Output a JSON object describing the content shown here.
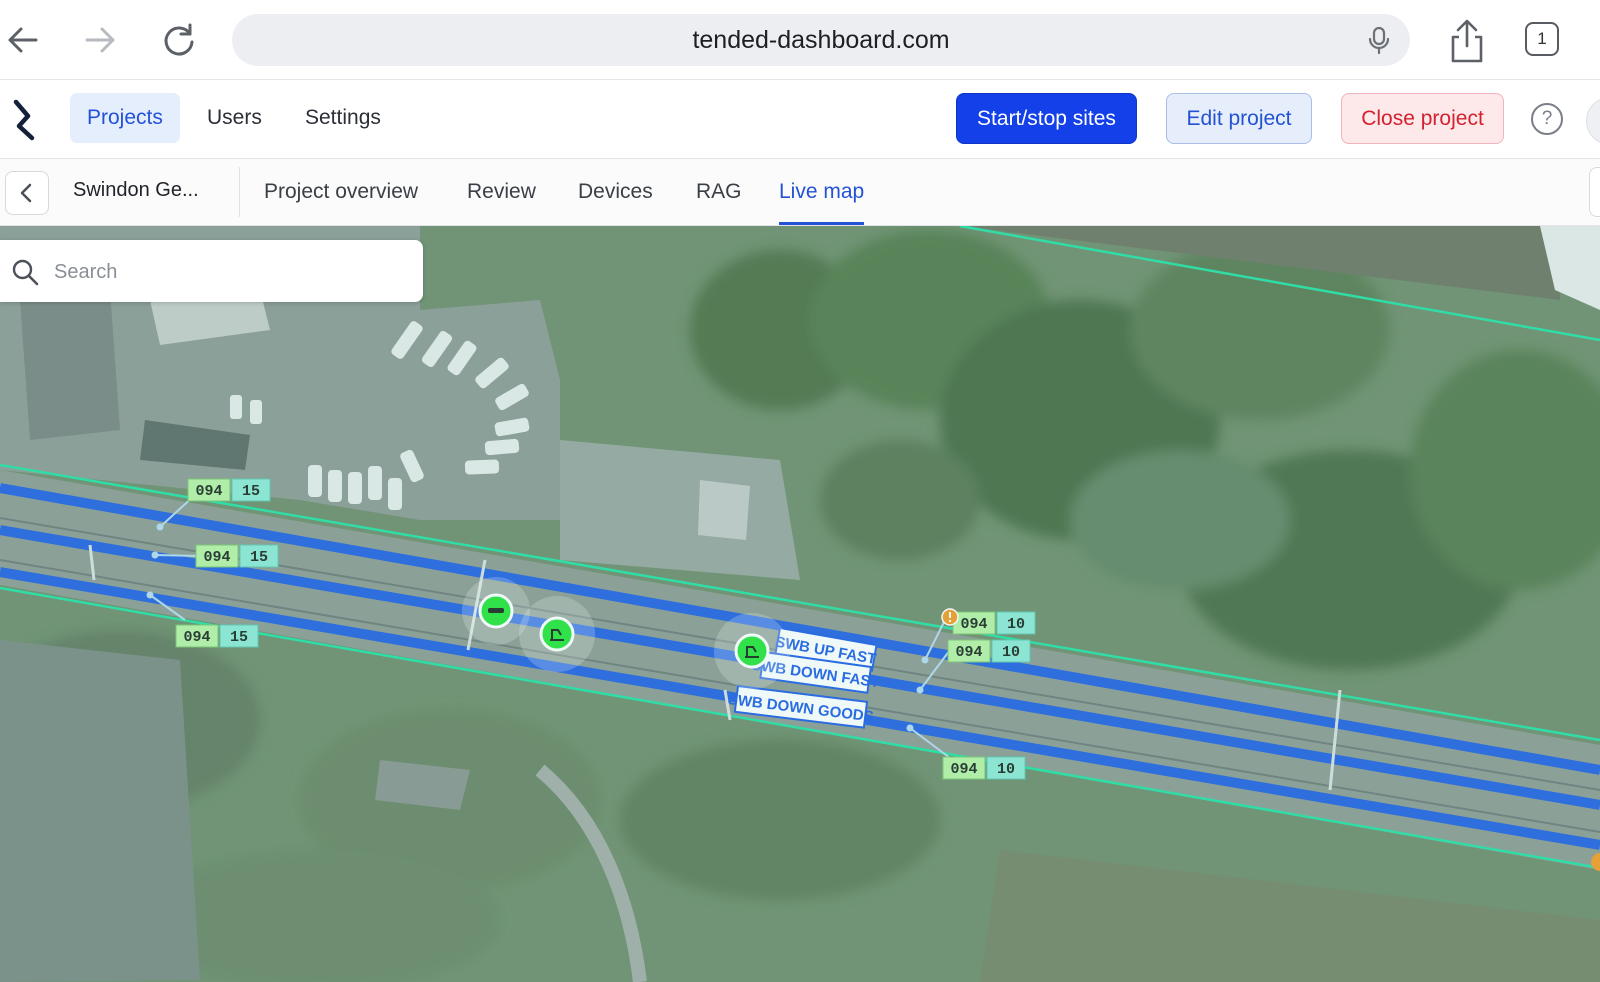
{
  "browser": {
    "url": "tended-dashboard.com",
    "tab_count": "1"
  },
  "header": {
    "nav": [
      {
        "label": "Projects",
        "active": true
      },
      {
        "label": "Users",
        "active": false
      },
      {
        "label": "Settings",
        "active": false
      }
    ],
    "start_stop_label": "Start/stop sites",
    "edit_label": "Edit project",
    "close_label": "Close project",
    "help_symbol": "?"
  },
  "project": {
    "name": "Swindon Ge...",
    "tabs": [
      {
        "label": "Project overview",
        "active": false
      },
      {
        "label": "Review",
        "active": false
      },
      {
        "label": "Devices",
        "active": false
      },
      {
        "label": "RAG",
        "active": false
      },
      {
        "label": "Live map",
        "active": true
      }
    ]
  },
  "search": {
    "placeholder": "Search"
  },
  "map": {
    "track_labels": [
      "SWB UP FAST",
      "SWB DOWN FAST",
      "SWB DOWN GOODS"
    ],
    "mileposts": [
      {
        "miles": "094",
        "chains": "15"
      },
      {
        "miles": "094",
        "chains": "15"
      },
      {
        "miles": "094",
        "chains": "15"
      },
      {
        "miles": "094",
        "chains": "10"
      },
      {
        "miles": "094",
        "chains": "10"
      },
      {
        "miles": "094",
        "chains": "10"
      }
    ],
    "device_markers": [
      {
        "type": "horn-device"
      },
      {
        "type": "lookout-device"
      },
      {
        "type": "lookout-device"
      }
    ],
    "colors": {
      "track": "#1f5fe6",
      "boundary": "#27e0a3",
      "marker": "#27e43a",
      "milepost_bg": "#b7f2a6",
      "chain_bg": "#8fe9d5",
      "warning": "#f49a24"
    }
  }
}
